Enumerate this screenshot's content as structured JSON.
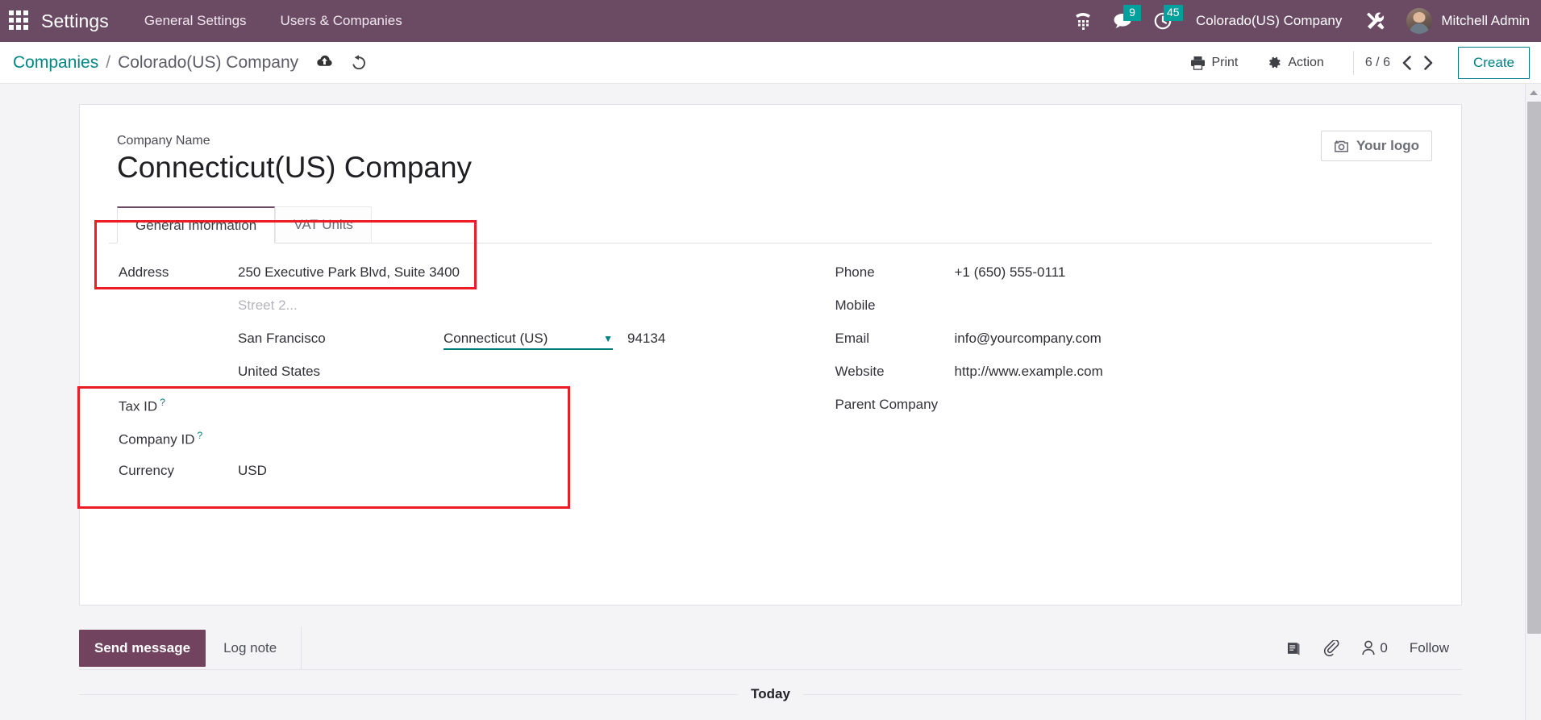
{
  "navbar": {
    "apps_icon": "apps-grid-icon",
    "brand": "Settings",
    "menus": [
      "General Settings",
      "Users & Companies"
    ],
    "phone_icon": "phone-dialpad-icon",
    "messages_icon": "chat-bubble-icon",
    "messages_count": "9",
    "activities_icon": "clock-icon",
    "activities_count": "45",
    "company_switcher": "Colorado(US) Company",
    "tools_icon": "developer-tools-icon",
    "avatar_icon": "user-avatar",
    "username": "Mitchell Admin",
    "bg_color": "#6B4A63",
    "badge_color": "#00A09D"
  },
  "control_panel": {
    "breadcrumb_root": "Companies",
    "breadcrumb_separator": "/",
    "breadcrumb_current": "Colorado(US) Company",
    "save_icon": "cloud-upload-icon",
    "discard_icon": "undo-icon",
    "print_label": "Print",
    "print_icon": "printer-icon",
    "action_label": "Action",
    "action_icon": "gear-icon",
    "pager": "6 / 6",
    "prev_icon": "chevron-left-icon",
    "next_icon": "chevron-right-icon",
    "create_label": "Create",
    "accent_color": "#017E84"
  },
  "form": {
    "logo_button": "Your logo",
    "logo_icon": "camera-plus-icon",
    "company_name_label": "Company Name",
    "company_name_value": "Connecticut(US) Company",
    "tabs": [
      {
        "label": "General Information",
        "active": true
      },
      {
        "label": "VAT Units",
        "active": false
      }
    ],
    "left": {
      "address_label": "Address",
      "street": "250 Executive Park Blvd, Suite 3400",
      "street2_placeholder": "Street 2...",
      "city": "San Francisco",
      "state": "Connecticut (US)",
      "state_caret_icon": "chevron-down-icon",
      "zip": "94134",
      "country": "United States",
      "tax_id_label": "Tax ID",
      "tax_id_value": "",
      "company_id_label": "Company ID",
      "company_id_value": "",
      "currency_label": "Currency",
      "currency_value": "USD",
      "help_marker": "?"
    },
    "right": {
      "phone_label": "Phone",
      "phone_value": "+1 (650) 555-0111",
      "mobile_label": "Mobile",
      "mobile_value": "",
      "email_label": "Email",
      "email_value": "info@yourcompany.com",
      "website_label": "Website",
      "website_value": "http://www.example.com",
      "parent_company_label": "Parent Company",
      "parent_company_value": ""
    },
    "annotation_color": "#ec1c24"
  },
  "chatter": {
    "send_message_label": "Send message",
    "log_note_label": "Log note",
    "log_icon": "activity-log-icon",
    "attachment_icon": "paperclip-icon",
    "followers_icon": "followers-person-icon",
    "followers_count": "0",
    "follow_label": "Follow",
    "today_separator": "Today"
  },
  "scrollbar": {
    "up_arrow_icon": "scroll-up-arrow-icon"
  }
}
